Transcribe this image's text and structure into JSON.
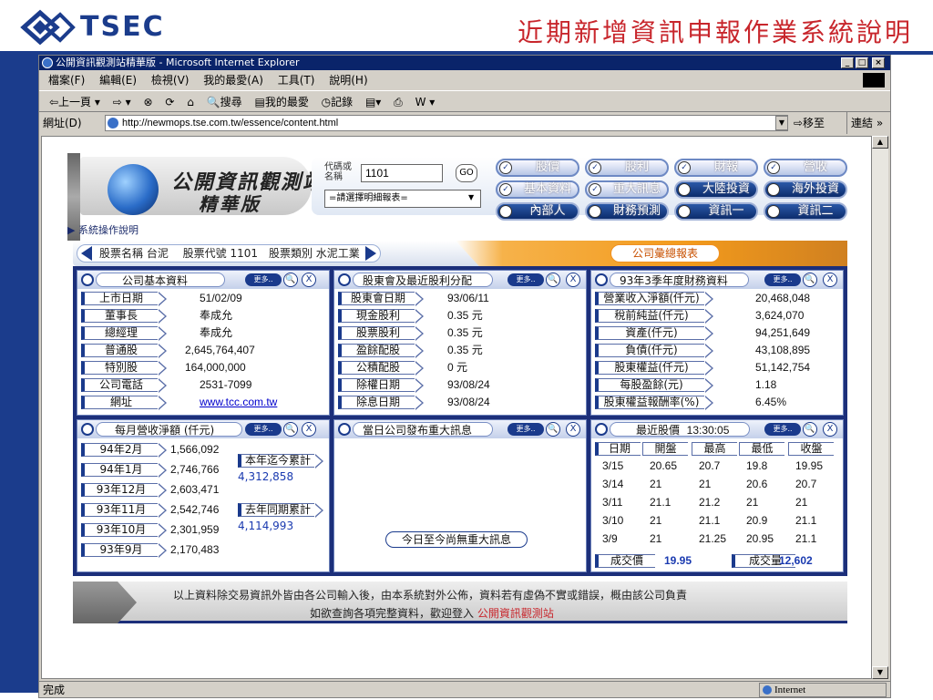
{
  "slide": {
    "logo_text": "TSEC",
    "title": "近期新增資訊申報作業系統說明"
  },
  "browser": {
    "title": "公開資訊觀測站精華版 - Microsoft Internet Explorer",
    "window_buttons": [
      "_",
      "□",
      "×"
    ],
    "menu": [
      "檔案(F)",
      "編輯(E)",
      "檢視(V)",
      "我的最愛(A)",
      "工具(T)",
      "說明(H)"
    ],
    "toolbar": [
      "⇦上一頁 ▾",
      "⇨ ▾",
      "⊗",
      "⟳",
      "⌂",
      "🔍搜尋",
      "▤我的最愛",
      "◷記錄",
      "▤▾",
      "⎙",
      "W ▾"
    ],
    "address_label": "網址(D)",
    "address": "http://newmops.tse.com.tw/essence/content.html",
    "go_label": "⇨移至",
    "links_label": "連結 »",
    "status_text": "完成",
    "zone_text": "Internet"
  },
  "site": {
    "logo_line1": "公開資訊觀測站",
    "logo_line2": "精華版",
    "code_label": "代碼或\n名稱",
    "code_value": "1101",
    "go_button": "GO",
    "select_value": "=請選擇明細報表=",
    "nav_row1": [
      "股價",
      "股利",
      "財報",
      "營收"
    ],
    "nav_row2": [
      "基本資料",
      "重大訊息",
      "大陸投資",
      "海外投資"
    ],
    "nav_row3": [
      "內部人",
      "財務預測",
      "資訊一",
      "資訊二"
    ],
    "sysop_link": "▶ 系統操作說明",
    "stock_info": "股票名稱 台泥　 股票代號 1101　股票類別 水泥工業",
    "report_button": "公司彙總報表",
    "more": "更多..",
    "zoom": "🔍",
    "close": "X"
  },
  "basic": {
    "title": "公司基本資料",
    "rows": [
      {
        "label": "上市日期",
        "value": "51/02/09"
      },
      {
        "label": "董事長",
        "value": "奉成允"
      },
      {
        "label": "總經理",
        "value": "奉成允"
      },
      {
        "label": "普通股",
        "value": "2,645,764,407"
      },
      {
        "label": "特別股",
        "value": "164,000,000"
      },
      {
        "label": "公司電話",
        "value": "2531-7099"
      },
      {
        "label": "網址",
        "value": "www.tcc.com.tw"
      }
    ]
  },
  "dividend": {
    "title": "股東會及最近股利分配",
    "rows": [
      {
        "label": "股東會日期",
        "value": "93/06/11"
      },
      {
        "label": "現金股利",
        "value": "0.35 元"
      },
      {
        "label": "股票股利",
        "value": "0.35 元"
      },
      {
        "label": "盈餘配股",
        "value": "0.35 元"
      },
      {
        "label": "公積配股",
        "value": "0 元"
      },
      {
        "label": "除權日期",
        "value": "93/08/24"
      },
      {
        "label": "除息日期",
        "value": "93/08/24"
      }
    ]
  },
  "finance": {
    "title": "93年3季年度財務資料",
    "rows": [
      {
        "label": "營業收入淨額(仟元)",
        "value": "20,468,048"
      },
      {
        "label": "稅前純益(仟元)",
        "value": "3,624,070"
      },
      {
        "label": "資產(仟元)",
        "value": "94,251,649"
      },
      {
        "label": "負債(仟元)",
        "value": "43,108,895"
      },
      {
        "label": "股東權益(仟元)",
        "value": "51,142,754"
      },
      {
        "label": "每股盈餘(元)",
        "value": "1.18"
      },
      {
        "label": "股東權益報酬率(%)",
        "value": "6.45%"
      }
    ]
  },
  "revenue": {
    "title": "每月營收淨額 (仟元)",
    "rows": [
      {
        "label": "94年2月",
        "value": "1,566,092"
      },
      {
        "label": "94年1月",
        "value": "2,746,766"
      },
      {
        "label": "93年12月",
        "value": "2,603,471"
      },
      {
        "label": "93年11月",
        "value": "2,542,746"
      },
      {
        "label": "93年10月",
        "value": "2,301,959"
      },
      {
        "label": "93年9月",
        "value": "2,170,483"
      }
    ],
    "ytd_label": "本年迄今累計",
    "ytd_value": "4,312,858",
    "last_label": "去年同期累計",
    "last_value": "4,114,993"
  },
  "news": {
    "title": "當日公司發布重大訊息",
    "empty": "今日至今尚無重大訊息"
  },
  "price": {
    "title": "最近股價",
    "time": "13:30:05",
    "headers": [
      "日期",
      "開盤",
      "最高",
      "最低",
      "收盤"
    ],
    "rows": [
      [
        "3/15",
        "20.65",
        "20.7",
        "19.8",
        "19.95"
      ],
      [
        "3/14",
        "21",
        "21",
        "20.6",
        "20.7"
      ],
      [
        "3/11",
        "21.1",
        "21.2",
        "21",
        "21"
      ],
      [
        "3/10",
        "21",
        "21.1",
        "20.9",
        "21.1"
      ],
      [
        "3/9",
        "21",
        "21.25",
        "20.95",
        "21.1"
      ]
    ],
    "deal_label": "成交價",
    "deal_value": "19.95",
    "vol_label": "成交量",
    "vol_value": "12,602"
  },
  "footer": {
    "line1": "以上資料除交易資訊外皆由各公司輸入後，由本系統對外公佈，資料若有虛偽不實或錯誤，概由該公司負責",
    "line2_prefix": "如欲查詢各項完整資料，歡迎登入",
    "line2_link": "公開資訊觀測站"
  }
}
